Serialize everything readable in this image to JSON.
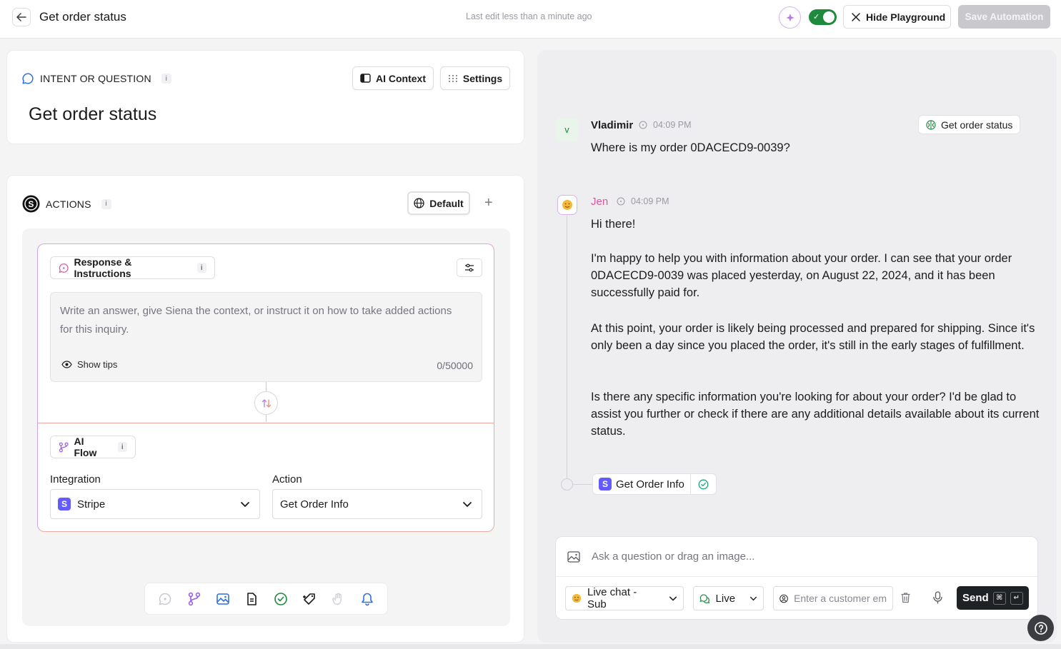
{
  "header": {
    "title": "Get order status",
    "last_edit": "Last edit less than a minute ago",
    "hide_playground": "Hide Playground",
    "save_automation": "Save Automation",
    "toggle_on": true
  },
  "intent": {
    "section_label": "INTENT OR QUESTION",
    "info": "i",
    "title": "Get order status",
    "ai_context": "AI Context",
    "settings": "Settings"
  },
  "actions": {
    "section_label": "ACTIONS",
    "info": "i",
    "default_label": "Default",
    "response": {
      "label": "Response & Instructions",
      "info": "i",
      "placeholder": "Write an answer, give Siena the context, or instruct it on how to take added actions for this inquiry.",
      "show_tips": "Show tips",
      "counter": "0/50000"
    },
    "ai_flow": {
      "label": "AI Flow",
      "info": "i",
      "integration_label": "Integration",
      "integration_value": "Stripe",
      "action_label": "Action",
      "action_value": "Get Order Info"
    }
  },
  "chat": {
    "messages": [
      {
        "avatar": "v",
        "name": "Vladimir",
        "time": "04:09 PM",
        "text": "Where is my order 0DACECD9-0039?"
      },
      {
        "avatar": "emoji-face",
        "name": "Jen",
        "time": "04:09 PM",
        "paragraphs": [
          "Hi there!",
          "I'm happy to help you with information about your order. I can see that your order 0DACECD9-0039 was placed yesterday, on August 22, 2024, and it has been successfully paid for.",
          "At this point, your order is likely being processed and prepared for shipping. Since it's only been a day since you placed the order, it's still in the early stages of fulfillment.",
          "Is there any specific information you're looking for about your order? I'd be glad to assist you further or check if there are any additional details available about its current status."
        ]
      }
    ],
    "intent_chip": "Get order status",
    "action_chip": "Get Order Info",
    "action_chip_icon": "S"
  },
  "composer": {
    "placeholder": "Ask a question or drag an image...",
    "channel": "Live chat - Sub",
    "mode": "Live",
    "customer_placeholder": "Enter a customer em",
    "send": "Send",
    "kbd_cmd": "⌘",
    "kbd_enter": "↵"
  },
  "colors": {
    "accent_green": "#1e8a3d",
    "stripe_purple": "#635bff",
    "jen_name": "#d65a9c",
    "flow_border": "#f0a8a0"
  }
}
